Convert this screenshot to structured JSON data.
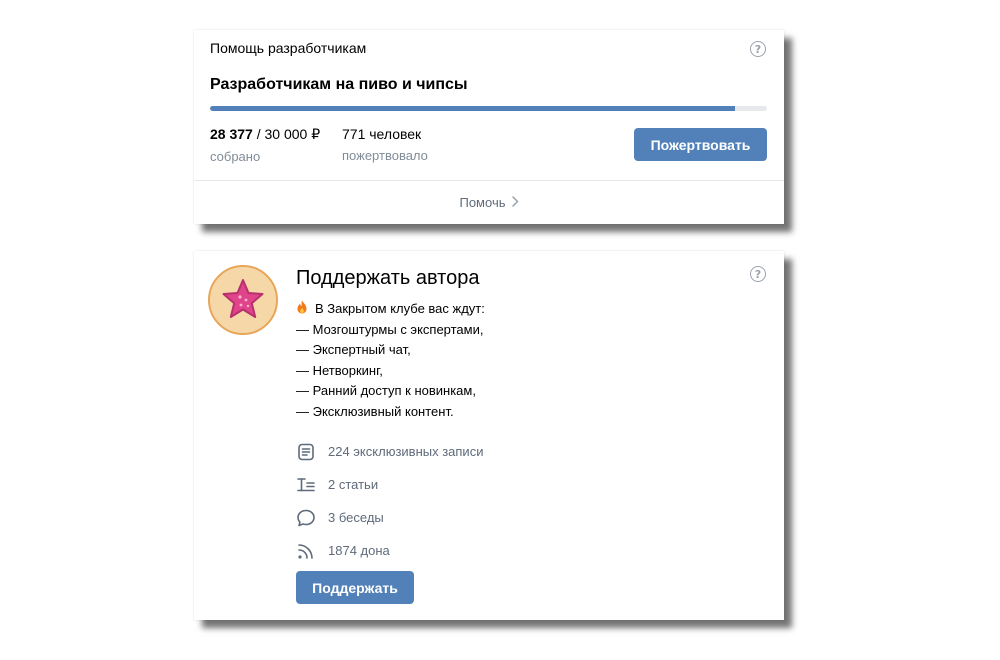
{
  "fundraiser": {
    "header": "Помощь разработчикам",
    "title": "Разработчикам на пиво и чипсы",
    "progress": 0.943,
    "collected": {
      "amount": "28 377",
      "goal": " / 30 000 ₽",
      "label": "собрано"
    },
    "donors": {
      "count": "771 человек",
      "label": "пожертвовало"
    },
    "donate_button": "Пожертвовать",
    "footer_link": "Помочь",
    "help_icon": "question-circle-icon"
  },
  "donut": {
    "title": "Поддержать автора",
    "description": [
      "В Закрытом клубе вас ждут:",
      "— Мозгоштурмы с экспертами,",
      "— Экспертный чат,",
      "— Нетворкинг,",
      "— Ранний доступ к новинкам,",
      "— Эксклюзивный контент."
    ],
    "stats": [
      {
        "icon": "posts-icon",
        "text": "224 эксклюзивных записи"
      },
      {
        "icon": "articles-icon",
        "text": "2 статьи"
      },
      {
        "icon": "chat-bubble-icon",
        "text": "3 беседы"
      },
      {
        "icon": "rss-icon",
        "text": "1874 дона"
      }
    ],
    "support_button": "Поддержать",
    "help_icon": "question-circle-icon"
  },
  "colors": {
    "accent": "#5181b8",
    "secondary_text": "#818c99",
    "divider": "#e7e8ec",
    "avatar_bg": "#f6d8a8",
    "star": "#e0448a"
  }
}
